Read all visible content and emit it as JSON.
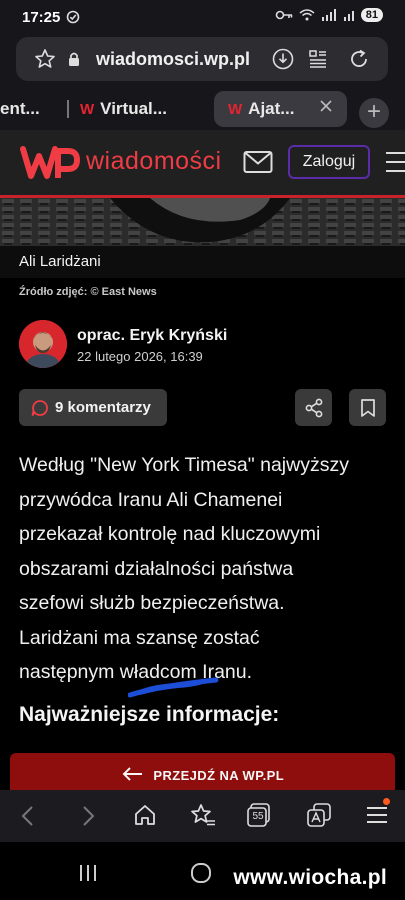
{
  "status_bar": {
    "time": "17:25",
    "battery": "81"
  },
  "browser": {
    "url": "wiadomosci.wp.pl",
    "tabs": [
      {
        "label": "ent..."
      },
      {
        "label": "Virtual..."
      },
      {
        "label": "Ajat..."
      }
    ],
    "add_tab_label": "+"
  },
  "site": {
    "logo_text": "wiadomości",
    "login_label": "Zaloguj"
  },
  "article": {
    "image_caption": "Ali Laridżani",
    "photo_source": "Źródło zdjęć: © East News",
    "author": "oprac. Eryk Kryński",
    "date": "22 lutego 2026, 16:39",
    "comments_label": "9 komentarzy",
    "body_lines": [
      "Według \"New York Timesa\" najwyższy",
      "przywódca Iranu Ali Chamenei",
      "przekazał kontrolę nad kluczowymi",
      "obszarami działalności państwa",
      "szefowi służb bezpieczeństwa.",
      "Laridżani ma szansę zostać",
      "następnym władcom Iranu."
    ],
    "section_heading": "Najważniejsze informacje:",
    "cta_label": "PRZEJDŹ NA WP.PL"
  },
  "bottom_nav": {
    "tab_count": "55"
  },
  "watermark": "www.wiocha.pl"
}
